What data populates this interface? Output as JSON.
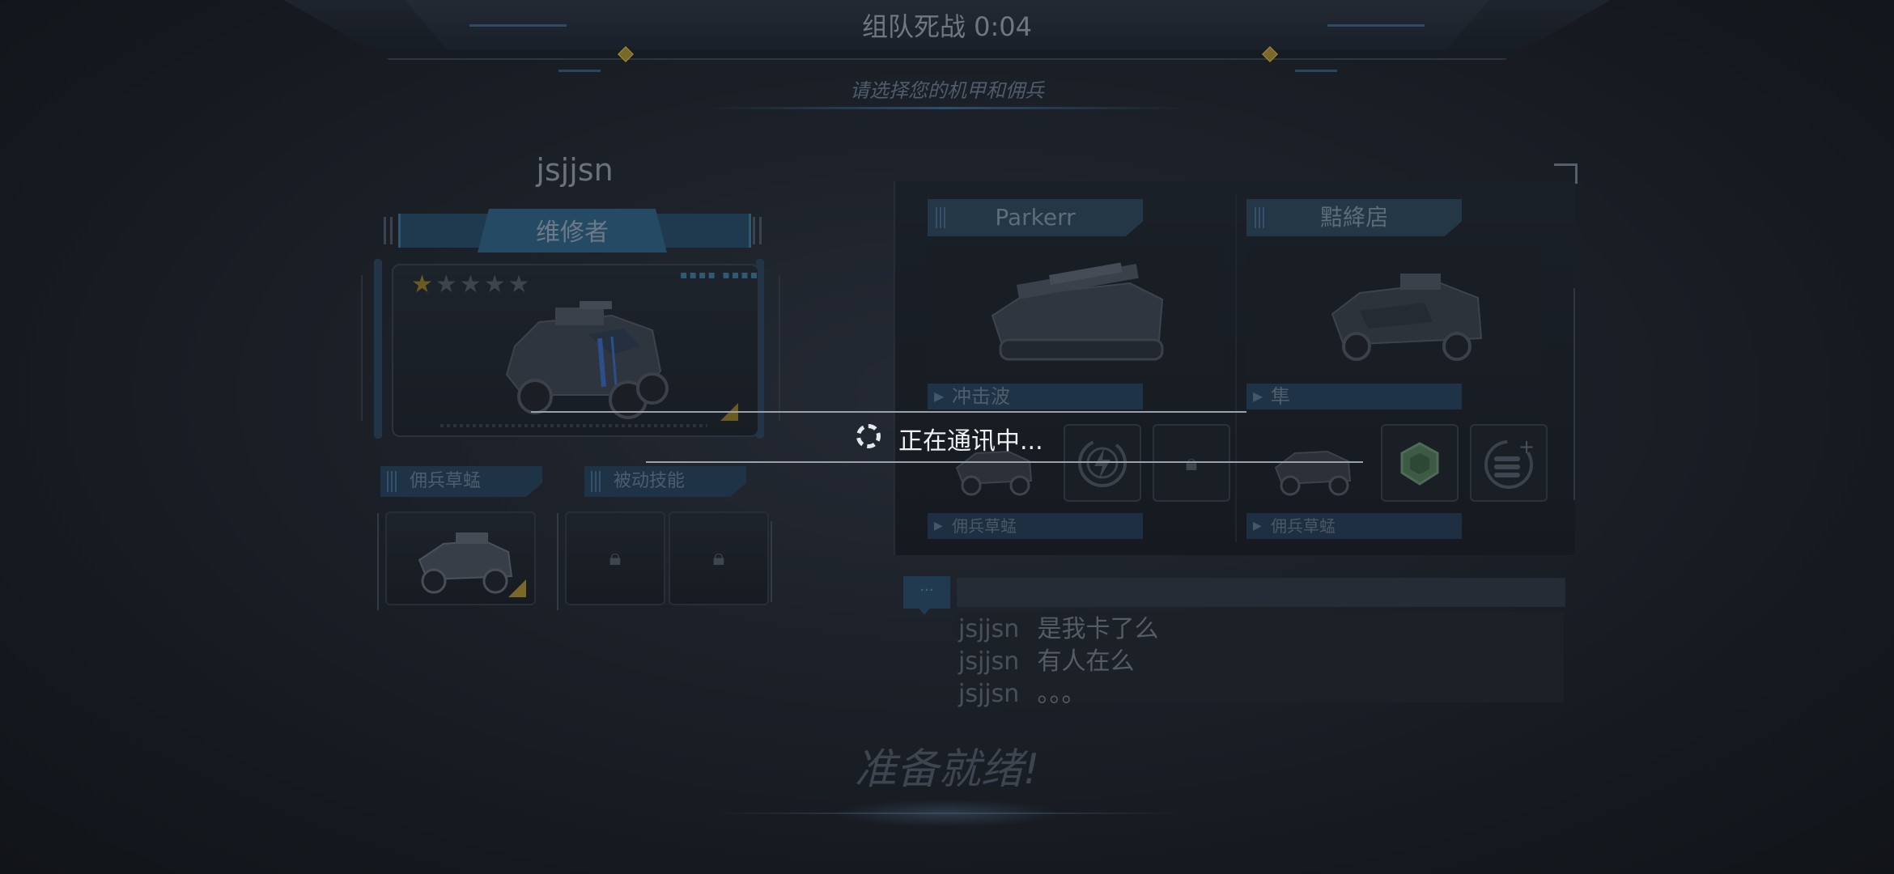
{
  "header": {
    "title": "组队死战 0:04",
    "subtitle": "请选择您的机甲和佣兵"
  },
  "player": {
    "name": "jsjjsn",
    "role": "维修者",
    "stars_total": 5,
    "stars_filled": 1,
    "mercenary_label": "佣兵草蜢",
    "passive_label": "被动技能"
  },
  "team": [
    {
      "name": "Parkerr",
      "skill": "冲击波",
      "mercenary": "佣兵草蜢"
    },
    {
      "name": "黠絳扂",
      "skill": "隼",
      "mercenary": "佣兵草蜢"
    }
  ],
  "chat": {
    "tab_label": "···",
    "messages": [
      {
        "user": "jsjjsn",
        "text": "是我卡了么"
      },
      {
        "user": "jsjjsn",
        "text": "有人在么"
      },
      {
        "user": "jsjjsn",
        "text": "。。。"
      }
    ]
  },
  "ready_label": "准备就绪!",
  "loading": {
    "text": "正在通讯中..."
  },
  "colors": {
    "accent_blue": "#254a63",
    "star_gold": "#6b5a22",
    "background": "#191d24"
  }
}
